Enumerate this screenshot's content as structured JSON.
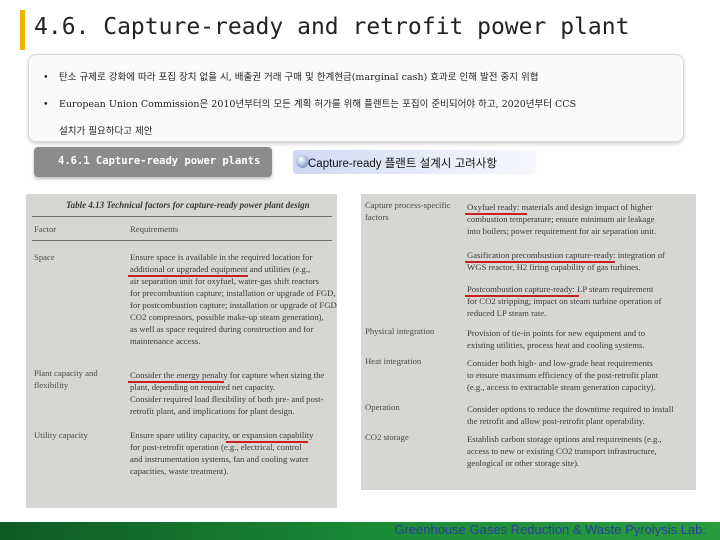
{
  "slide": {
    "title": "4.6. Capture-ready and retrofit power plant",
    "bullets": [
      {
        "mark": "•",
        "text": "탄소 규제로 강화에 따라 포집 장치 없을 시, 배출권 거래 구매 및 한계현금(marginal cash) 효과로 인해 발전 중지 위협"
      },
      {
        "mark": "•",
        "text": "European Union Commission은 2010년부터의 모든 계획 허가를 위해 플랜트는 포집이 준비되어야 하고, 2020년부터 CCS"
      },
      {
        "mark": "",
        "text": "설치가 필요하다고 제안"
      }
    ],
    "tab_left": "4.6.1 Capture-ready power plants",
    "tab_right": "Capture-ready 플랜트 설계시 고려사항",
    "footer": "Greenhouse Gases Reduction & Waste Pyrolysis Lab.",
    "colors": {
      "accent": "#f0b400",
      "footer_green": "#1b8d37",
      "footer_text": "#2b3f9e",
      "underline": "#c72222"
    }
  },
  "scan_left": {
    "caption": "Table 4.13  Technical factors for capture-ready power plant design",
    "col_factor": "Factor",
    "col_requirements": "Requirements",
    "factors": [
      "Space",
      "Plant capacity and",
      "flexibility",
      "Utility capacity"
    ],
    "lines": [
      "Ensure space is available in the required location for",
      "additional or upgraded equipment and utilities (e.g.,",
      "air separation unit for oxyfuel, water-gas shift reactors",
      "for precombustion capture; installation or upgrade of FGD,",
      "for postcombustion capture; installation or upgrade of FGD,",
      "CO2 compressors, possible make-up steam generation),",
      "as well as space required during construction and for",
      "maintenance access.",
      "Consider the energy penalty for capture when sizing the",
      "plant, depending on required net capacity.",
      "Consider required load flexibility of both pre- and post-",
      "retrofit plant, and implications for plant design.",
      "Ensure spare utility capacity, or expansion capability",
      "for post-retrofit operation (e.g., electrical, control",
      "and instrumentation systems, fan and cooling water",
      "capacities, waste treatment)."
    ]
  },
  "scan_right": {
    "factors": [
      "Capture process-specific",
      "factors",
      "Physical integration",
      "Heat integration",
      "Operation",
      "CO2 storage"
    ],
    "lines": [
      "Oxyfuel ready: materials and design impact of higher",
      "combustion temperature; ensure minimum air leakage",
      "into boilers; power requirement for air separation unit.",
      "Gasification precombustion capture-ready: integration of",
      "WGS reactor, H2 firing capability of gas turbines.",
      "Postcombustion capture-ready: LP steam requirement",
      "for CO2 stripping; impact on steam turbine operation of",
      "reduced LP steam rate.",
      "Provision of tie-in points for new equipment and to",
      "existing utilities, process heat and cooling systems.",
      "Consider both high- and low-grade heat requirements",
      "to ensure maximum efficiency of the post-retrofit plant",
      "(e.g., access to extractable steam generation capacity).",
      "Consider options to reduce the downtime required to install",
      "the retrofit and allow post-retrofit plant operability.",
      "Establish carbon storage options and requirements (e.g.,",
      "access to new or existing CO2 transport infrastructure,",
      "geological or other storage site)."
    ]
  }
}
